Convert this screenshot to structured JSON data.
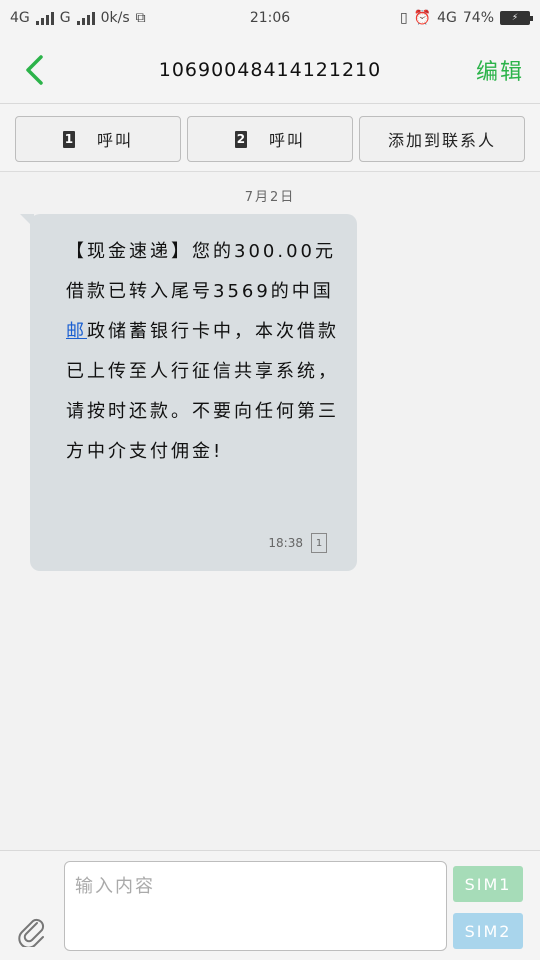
{
  "status_bar": {
    "network1": "4G",
    "network2": "G",
    "speed": "0k/s",
    "time": "21:06",
    "network3": "4G",
    "battery_level": "74",
    "battery_symbol": "%"
  },
  "header": {
    "title": "10690048414121210",
    "edit_label": "编辑"
  },
  "actions": {
    "call1_sim": "1",
    "call1_label": "呼叫",
    "call2_sim": "2",
    "call2_label": "呼叫",
    "add_contact_label": "添加到联系人"
  },
  "conversation": {
    "date": "7月2日",
    "message": {
      "text_before": "【现金速递】您的300.00元借款已转入尾号3569的中国",
      "link_text": "邮",
      "text_after": "政储蓄银行卡中，本次借款已上传至人行征信共享系统，请按时还款。不要向任何第三方中介支付佣金!",
      "time": "18:38",
      "sim": "1"
    }
  },
  "input_bar": {
    "placeholder": "输入内容",
    "sim1_label": "SIM1",
    "sim2_label": "SIM2"
  },
  "colors": {
    "accent": "#2cb34a",
    "bubble": "#d9dee1",
    "sim1_button": "#a6dcb8",
    "sim2_button": "#a9d5ec",
    "link": "#1a5fd1"
  }
}
